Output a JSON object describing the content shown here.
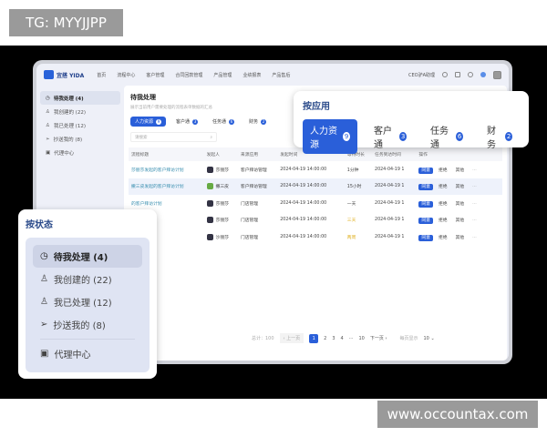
{
  "watermarks": {
    "top": "TG: MYYJJPP",
    "bottom": "www.occountax.com"
  },
  "nav": {
    "brand": "宜搭 YIDA",
    "items": [
      "首页",
      "流程中心",
      "客户管理",
      "合同回款管理",
      "产品管理",
      "业绩报表",
      "产品售后"
    ],
    "user": "CEO驴A助理"
  },
  "sidebar": {
    "items": [
      {
        "label": "待我处理 (4)",
        "icon": "clock-icon"
      },
      {
        "label": "我创建的 (22)",
        "icon": "user-add-icon"
      },
      {
        "label": "我已处理 (12)",
        "icon": "user-check-icon"
      },
      {
        "label": "抄送我的 (8)",
        "icon": "send-icon"
      },
      {
        "label": "代理中心",
        "icon": "agent-icon"
      }
    ]
  },
  "main": {
    "title": "待我处理",
    "subtitle": "展示当前用户需要处理的流程表单数据的汇总",
    "tabs": [
      {
        "label": "人力资源",
        "count": "9"
      },
      {
        "label": "客户通",
        "count": "3"
      },
      {
        "label": "任务通",
        "count": "6"
      },
      {
        "label": "财务",
        "count": "2"
      }
    ],
    "search_placeholder": "请搜索",
    "columns": [
      "流程标题",
      "发起人",
      "来源应用",
      "发起时间",
      "等待时长",
      "任务到达时间",
      "操作"
    ],
    "rows": [
      {
        "title": "莎丽莎发起的客户拜访计划",
        "user": "莎丽莎",
        "app": "客户拜访管理",
        "time": "2024-04-19 14:00:00",
        "wait": "1分钟",
        "arrive": "2024-04-19 1"
      },
      {
        "title": "撒三皮发起的客户拜访计划",
        "user": "撒三皮",
        "app": "客户拜访管理",
        "time": "2024-04-19 14:00:00",
        "wait": "15小时",
        "arrive": "2024-04-19 1"
      },
      {
        "title": "的客户拜访计划",
        "user": "莎丽莎",
        "app": "门店管理",
        "time": "2024-04-19 14:00:00",
        "wait": "一天",
        "arrive": "2024-04-19 1"
      },
      {
        "title": "的门店巡检",
        "user": "莎丽莎",
        "app": "门店管理",
        "time": "2024-04-19 14:00:00",
        "wait": "三天",
        "arrive": "2024-04-19 1"
      },
      {
        "title": "的门店巡检",
        "user": "沙丽莎",
        "app": "门店管理",
        "time": "2024-04-19 14:00:00",
        "wait": "两周",
        "arrive": "2024-04-19 1"
      }
    ],
    "actions": [
      "同意",
      "拒绝",
      "其他",
      "···"
    ],
    "pager": {
      "total": "总计：100",
      "prev": "上一页",
      "pages": [
        "1",
        "2",
        "3",
        "4",
        "···",
        "10"
      ],
      "next": "下一页",
      "per_page_label": "每页显示",
      "per_page": "10"
    }
  },
  "status_card": {
    "title": "按状态"
  },
  "app_card": {
    "title": "按应用"
  },
  "colors": {
    "accent": "#2a5fd9",
    "warn": "#e0b020"
  }
}
